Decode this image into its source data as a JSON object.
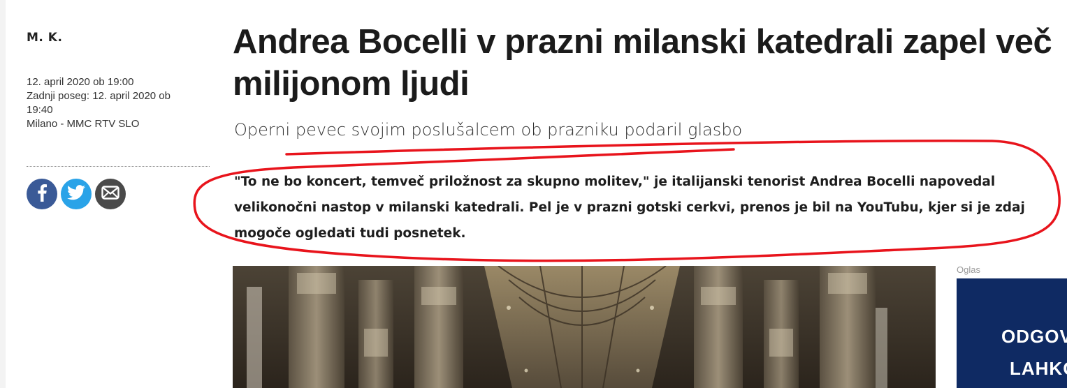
{
  "article": {
    "author": "M. K.",
    "published": "12. april 2020 ob 19:00",
    "updated_line1": "Zadnji poseg: 12. april 2020 ob",
    "updated_line2": "19:40",
    "source": "Milano - MMC RTV SLO",
    "headline": "Andrea Bocelli v prazni milanski katedrali zapel več milijonom ljudi",
    "subheadline": "Operni pevec svojim poslušalcem ob prazniku podaril glasbo",
    "lead": "\"To ne bo koncert, temveč priložnost za skupno molitev,\" je italijanski tenorist Andrea Bocelli napovedal velikonočni nastop v milanski katedrali. Pel je v prazni gotski cerkvi, prenos je bil na YouTubu, kjer si je zdaj mogoče ogledati tudi posnetek."
  },
  "share": {
    "icons": [
      "facebook-icon",
      "twitter-icon",
      "mail-icon"
    ],
    "colors": {
      "facebook": "#3a5a97",
      "twitter": "#2aa3e8",
      "mail": "#4a4a4a"
    }
  },
  "ad": {
    "label": "Oglas",
    "line1": "ODGOV",
    "line2": "LAHKO",
    "background": "#0f2a63"
  },
  "annotation": {
    "color": "#e8141c"
  }
}
